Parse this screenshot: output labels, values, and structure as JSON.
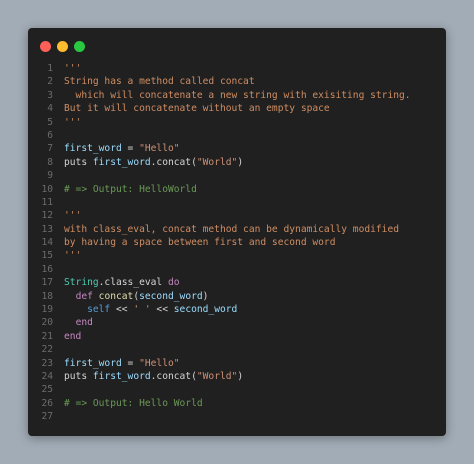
{
  "window": {
    "controls": [
      "close",
      "minimize",
      "zoom"
    ]
  },
  "colors": {
    "background": "#a2acb6",
    "editor_bg": "#202020",
    "close": "#fe5f57",
    "minimize": "#febc2e",
    "zoom": "#28c840"
  },
  "code": {
    "lines": [
      {
        "n": "1",
        "tokens": [
          {
            "t": "'''",
            "c": "comment"
          }
        ]
      },
      {
        "n": "2",
        "tokens": [
          {
            "t": "String has a method called concat",
            "c": "comment"
          }
        ]
      },
      {
        "n": "3",
        "tokens": [
          {
            "t": "  which will concatenate a new string with exisiting string.",
            "c": "comment"
          }
        ]
      },
      {
        "n": "4",
        "tokens": [
          {
            "t": "But it will concatenate without an empty space",
            "c": "comment"
          }
        ]
      },
      {
        "n": "5",
        "tokens": [
          {
            "t": "'''",
            "c": "comment"
          }
        ]
      },
      {
        "n": "6",
        "tokens": []
      },
      {
        "n": "7",
        "tokens": [
          {
            "t": "first_word",
            "c": "var"
          },
          {
            "t": " = ",
            "c": "op"
          },
          {
            "t": "\"Hello\"",
            "c": "string"
          }
        ]
      },
      {
        "n": "8",
        "tokens": [
          {
            "t": "puts ",
            "c": "default"
          },
          {
            "t": "first_word",
            "c": "var"
          },
          {
            "t": ".concat(",
            "c": "default"
          },
          {
            "t": "\"World\"",
            "c": "string"
          },
          {
            "t": ")",
            "c": "default"
          }
        ]
      },
      {
        "n": "9",
        "tokens": []
      },
      {
        "n": "10",
        "tokens": [
          {
            "t": "# => Output: HelloWorld",
            "c": "linecomment"
          }
        ]
      },
      {
        "n": "11",
        "tokens": []
      },
      {
        "n": "12",
        "tokens": [
          {
            "t": "'''",
            "c": "comment"
          }
        ]
      },
      {
        "n": "13",
        "tokens": [
          {
            "t": "with class_eval, concat method can be dynamically modified",
            "c": "comment"
          }
        ]
      },
      {
        "n": "14",
        "tokens": [
          {
            "t": "by having a space between first and second word",
            "c": "comment"
          }
        ]
      },
      {
        "n": "15",
        "tokens": [
          {
            "t": "'''",
            "c": "comment"
          }
        ]
      },
      {
        "n": "16",
        "tokens": []
      },
      {
        "n": "17",
        "tokens": [
          {
            "t": "String",
            "c": "const"
          },
          {
            "t": ".class_eval ",
            "c": "default"
          },
          {
            "t": "do",
            "c": "kw"
          }
        ]
      },
      {
        "n": "18",
        "tokens": [
          {
            "t": "  ",
            "c": "default"
          },
          {
            "t": "def",
            "c": "kw"
          },
          {
            "t": " ",
            "c": "default"
          },
          {
            "t": "concat",
            "c": "method"
          },
          {
            "t": "(",
            "c": "default"
          },
          {
            "t": "second_word",
            "c": "var"
          },
          {
            "t": ")",
            "c": "default"
          }
        ]
      },
      {
        "n": "19",
        "tokens": [
          {
            "t": "    ",
            "c": "default"
          },
          {
            "t": "self",
            "c": "self"
          },
          {
            "t": " << ",
            "c": "op"
          },
          {
            "t": "' '",
            "c": "string"
          },
          {
            "t": " << ",
            "c": "op"
          },
          {
            "t": "second_word",
            "c": "var"
          }
        ]
      },
      {
        "n": "20",
        "tokens": [
          {
            "t": "  ",
            "c": "default"
          },
          {
            "t": "end",
            "c": "kw"
          }
        ]
      },
      {
        "n": "21",
        "tokens": [
          {
            "t": "end",
            "c": "kw"
          }
        ]
      },
      {
        "n": "22",
        "tokens": []
      },
      {
        "n": "23",
        "tokens": [
          {
            "t": "first_word",
            "c": "var"
          },
          {
            "t": " = ",
            "c": "op"
          },
          {
            "t": "\"Hello\"",
            "c": "string"
          }
        ]
      },
      {
        "n": "24",
        "tokens": [
          {
            "t": "puts ",
            "c": "default"
          },
          {
            "t": "first_word",
            "c": "var"
          },
          {
            "t": ".concat(",
            "c": "default"
          },
          {
            "t": "\"World\"",
            "c": "string"
          },
          {
            "t": ")",
            "c": "default"
          }
        ]
      },
      {
        "n": "25",
        "tokens": []
      },
      {
        "n": "26",
        "tokens": [
          {
            "t": "# => Output: Hello World",
            "c": "linecomment"
          }
        ]
      },
      {
        "n": "27",
        "tokens": []
      }
    ]
  }
}
